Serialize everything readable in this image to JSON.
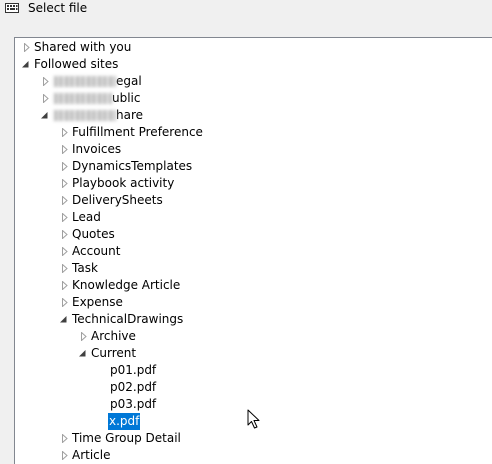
{
  "window": {
    "title": "Select file",
    "icon": "keyboard-icon"
  },
  "tree": {
    "shared_with_you": "Shared with you",
    "followed_sites": "Followed sites",
    "sites": [
      {
        "label_suffix": "egal",
        "redacted": true,
        "expanded": false
      },
      {
        "label_suffix": "ublic",
        "redacted": true,
        "expanded": false
      },
      {
        "label_suffix": "hare",
        "redacted": true,
        "expanded": true
      }
    ],
    "folders": [
      "Fulfillment Preference",
      "Invoices",
      "DynamicsTemplates",
      "Playbook activity",
      "DeliverySheets",
      "Lead",
      "Quotes",
      "Account",
      "Task",
      "Knowledge Article",
      "Expense",
      "TechnicalDrawings"
    ],
    "technical_drawings": {
      "archive": "Archive",
      "current": "Current",
      "files": [
        "p01.pdf",
        "p02.pdf",
        "p03.pdf",
        "x.pdf"
      ],
      "selected_file": "x.pdf"
    },
    "after_folders": [
      "Time Group Detail",
      "Article"
    ]
  },
  "colors": {
    "selection_bg": "#0078d7",
    "selection_fg": "#ffffff",
    "panel_bg": "#ffffff",
    "window_bg": "#f0f0f0"
  }
}
